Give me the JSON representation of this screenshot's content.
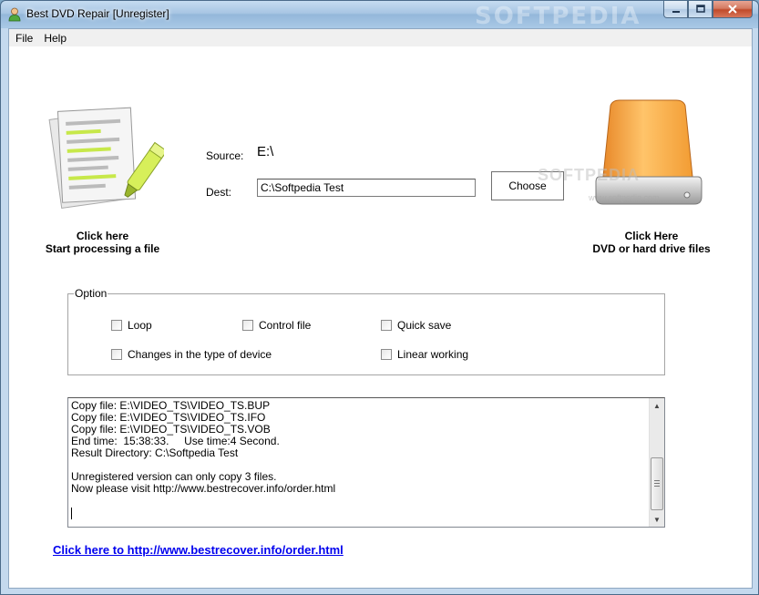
{
  "window": {
    "title": "Best DVD Repair [Unregister]",
    "watermark": "SOFTPEDIA"
  },
  "menu": {
    "items": [
      {
        "label": "File"
      },
      {
        "label": "Help"
      }
    ]
  },
  "left_action": {
    "line1": "Click here",
    "line2": "Start processing a file"
  },
  "right_action": {
    "line1": "Click Here",
    "line2": "DVD or hard drive files"
  },
  "source": {
    "label": "Source:",
    "value": "E:\\"
  },
  "dest": {
    "label": "Dest:",
    "value": "C:\\Softpedia Test"
  },
  "choose_button": {
    "label": "Choose"
  },
  "center_watermark": {
    "text": "SOFTPEDIA",
    "url": "www.softpedia.com"
  },
  "options": {
    "title": "Option",
    "loop": {
      "label": "Loop",
      "checked": false
    },
    "control_file": {
      "label": "Control file",
      "checked": false
    },
    "quick_save": {
      "label": "Quick save",
      "checked": false
    },
    "changes_device": {
      "label": "Changes in the type of device",
      "checked": false
    },
    "linear_working": {
      "label": "Linear working",
      "checked": false
    }
  },
  "log": {
    "text": "Copy file: E:\\VIDEO_TS\\VIDEO_TS.BUP\nCopy file: E:\\VIDEO_TS\\VIDEO_TS.IFO\nCopy file: E:\\VIDEO_TS\\VIDEO_TS.VOB\nEnd time:  15:38:33.     Use time:4 Second.\nResult Directory: C:\\Softpedia Test\n\nUnregistered version can only copy 3 files.\nNow please visit http://www.bestrecover.info/order.html"
  },
  "order_link": {
    "label": "Click here to http://www.bestrecover.info/order.html"
  },
  "colors": {
    "titlebar": "#a7c5e3",
    "drive_orange": "#f7a43a",
    "link": "#0000ee",
    "highlighter": "#c7e84a"
  }
}
